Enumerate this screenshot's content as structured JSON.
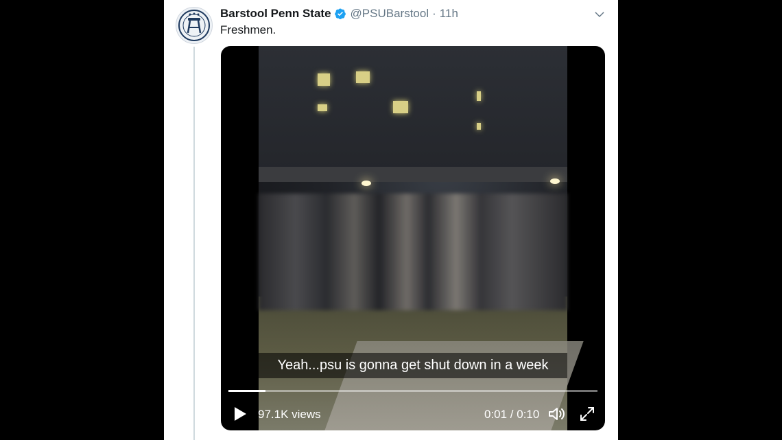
{
  "tweet": {
    "display_name": "Barstool Penn State",
    "handle": "@PSUBarstool",
    "separator": "·",
    "time": "11h",
    "text": "Freshmen.",
    "verified_color": "#1da1f2",
    "avatar_icon": "barstool-logo-icon",
    "menu_icon": "chevron-down-icon"
  },
  "video": {
    "caption": "Yeah...psu is gonna get shut down in a week",
    "views": "97.1K views",
    "timecode": "0:01 / 0:10",
    "progress": 0.1,
    "icons": {
      "play": "play-icon",
      "volume": "volume-icon",
      "fullscreen": "fullscreen-icon"
    }
  }
}
